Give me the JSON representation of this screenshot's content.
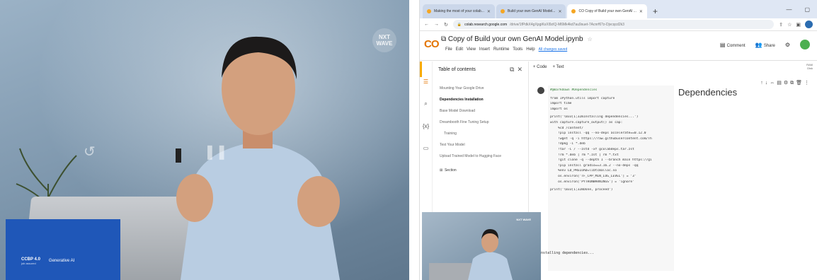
{
  "video": {
    "brand_badge": "NXT WAVE",
    "banner": {
      "program": "CCBP 4.0",
      "program_sub": "job assured",
      "course": "Generative AI"
    }
  },
  "browser": {
    "tabs": [
      {
        "label": "Making the most of your colab...",
        "active": false
      },
      {
        "label": "Build your own GenAI Model...",
        "active": false
      },
      {
        "label": "CO Copy of Build your own GenAI ...",
        "active": true
      }
    ],
    "url_host": "colab.research.google.com",
    "url_path": "/drive/1fPdkX4gXpgiKsXl9zIQ-M6Mk4kd7au9suet-7Acnrf6?z-Djvcqcd2k3",
    "colab": {
      "logo": "CO",
      "notebook_title": "Copy of Build your own GenAI Model.ipynb",
      "menus": [
        "File",
        "Edit",
        "View",
        "Insert",
        "Runtime",
        "Tools",
        "Help"
      ],
      "saved_status": "All changes saved",
      "comment_label": "Comment",
      "share_label": "Share",
      "ram_label": "RAM",
      "disk_label": "Disk",
      "add_code": "+ Code",
      "add_text": "+ Text",
      "toc_title": "Table of contents",
      "toc_items": [
        {
          "label": "Mounting Your Google Drive"
        },
        {
          "label": "Dependencies Installation"
        },
        {
          "label": "Base Model Download"
        },
        {
          "label": "Dreambooth Fine Tuning Setup"
        },
        {
          "label": "Training"
        },
        {
          "label": "Test Your Model"
        },
        {
          "label": "Upload Trained Model to Hugging Face"
        }
      ],
      "toc_section": "Section",
      "markdown_heading": "Dependencies",
      "code_lines": [
        "#@markdown #Dependencies",
        "",
        "from IPython.utils import capture",
        "import time",
        "import os",
        "",
        "print('\\033[1;32mInstalling dependencies...')",
        "with capture.capture_output() as cap:",
        "    %cd /content/",
        "    !pip install -qq --no-deps accelerate==0.12.0",
        "    !wget -q -i https://raw.githubusercontent.com/Th",
        "    !dpkg -i *.deb",
        "    !tar -C / --zstd -xf gcolabdeps.tar.zst",
        "    !rm *.deb | rm *.zst | rm *.txt",
        "    !git clone -q --depth 1 --branch main https://gi",
        "    !pip install gradio==3.16.2 --no-deps -qq",
        "    %env LD_PRELOAD=libtcmalloc.so",
        "    os.environ['TF_CPP_MIN_LOG_LEVEL'] = '3'",
        "    os.environ['PYTHONWARNINGS'] = 'ignore'",
        "",
        "print('\\033[1;32mDone, proceed')"
      ],
      "output_text": "Installing dependencies..."
    }
  }
}
